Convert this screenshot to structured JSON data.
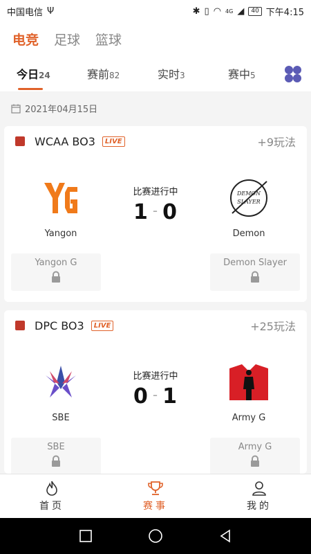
{
  "status_bar": {
    "carrier": "中国电信",
    "usb": "Ψ",
    "network": "4G",
    "battery": "40",
    "time": "下午4:15"
  },
  "sport_tabs": [
    {
      "label": "电竞",
      "active": true
    },
    {
      "label": "足球",
      "active": false
    },
    {
      "label": "篮球",
      "active": false
    }
  ],
  "status_tabs": [
    {
      "label": "今日",
      "count": "24",
      "active": true
    },
    {
      "label": "赛前",
      "count": "82",
      "active": false
    },
    {
      "label": "实时",
      "count": "3",
      "active": false
    },
    {
      "label": "赛中",
      "count": "5",
      "active": false
    }
  ],
  "date": "2021年04月15日",
  "matches": [
    {
      "league": "WCAA BO3",
      "live_badge": "LIVE",
      "plays": "+9玩法",
      "state": "比赛进行中",
      "score_home": "1",
      "score_sep": "-",
      "score_away": "0",
      "home": {
        "name": "Yangon",
        "odds_label": "Yangon G"
      },
      "away": {
        "name": "Demon",
        "odds_label": "Demon Slayer",
        "logo_text": "DEMON SLAYER"
      }
    },
    {
      "league": "DPC BO3",
      "live_badge": "LIVE",
      "plays": "+25玩法",
      "state": "比赛进行中",
      "score_home": "0",
      "score_sep": "-",
      "score_away": "1",
      "home": {
        "name": "SBE",
        "odds_label": "SBE"
      },
      "away": {
        "name": "Army G",
        "odds_label": "Army G"
      }
    }
  ],
  "bottom_nav": [
    {
      "label": "首页",
      "icon": "flame-icon",
      "active": false
    },
    {
      "label": "赛事",
      "icon": "trophy-icon",
      "active": true
    },
    {
      "label": "我的",
      "icon": "person-icon",
      "active": false
    }
  ],
  "colors": {
    "accent": "#e0622a",
    "grid_icon": "#5b5bb5"
  }
}
